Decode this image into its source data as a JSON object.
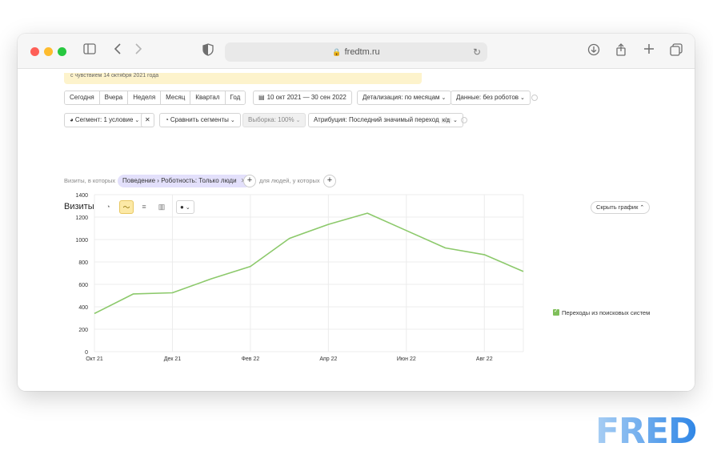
{
  "browser": {
    "url": "fredtm.ru"
  },
  "toolbar": {
    "banner_text": "с чувствием 14 октября 2021 года",
    "periods": [
      "Сегодня",
      "Вчера",
      "Неделя",
      "Месяц",
      "Квартал",
      "Год"
    ],
    "date_range": "10 окт 2021 — 30 сен 2022",
    "detail": "Детализация: по месяцам",
    "data": "Данные: без роботов",
    "segment": "Сегмент: 1 условие",
    "compare": "Сравнить сегменты",
    "sample": "Выборка: 100%",
    "attribution": "Атрибуция: Последний значимый переход",
    "attribution_badge": "к/д"
  },
  "filters": {
    "prefix": "Визиты, в которых",
    "chip": "Поведение › Роботность: Только люди",
    "suffix": "для людей, у которых"
  },
  "chart_header": {
    "title": "Визиты",
    "hide_button": "Скрыть график"
  },
  "colors": {
    "series": "#8cc96b",
    "grid": "#ececec",
    "fred_blue": "#3d8ee8",
    "fred_light": "#9cc8f2"
  },
  "logo": {
    "text": "FRED"
  },
  "chart_data": {
    "type": "line",
    "x_ticks": [
      "Окт 21",
      "Дек 21",
      "Фев 22",
      "Апр 22",
      "Июн 22",
      "Авг 22"
    ],
    "x": [
      "2021-10",
      "2021-11",
      "2021-12",
      "2022-01",
      "2022-02",
      "2022-03",
      "2022-04",
      "2022-05",
      "2022-06",
      "2022-07",
      "2022-08",
      "2022-09"
    ],
    "series": [
      {
        "name": "Переходы из поисковых систем",
        "values": [
          340,
          515,
          525,
          650,
          760,
          1010,
          1135,
          1235,
          1080,
          925,
          865,
          715
        ]
      }
    ],
    "ylim": [
      0,
      1400
    ],
    "yticks": [
      0,
      200,
      400,
      600,
      800,
      1000,
      1200,
      1400
    ],
    "grid": true,
    "legend_position": "right"
  }
}
